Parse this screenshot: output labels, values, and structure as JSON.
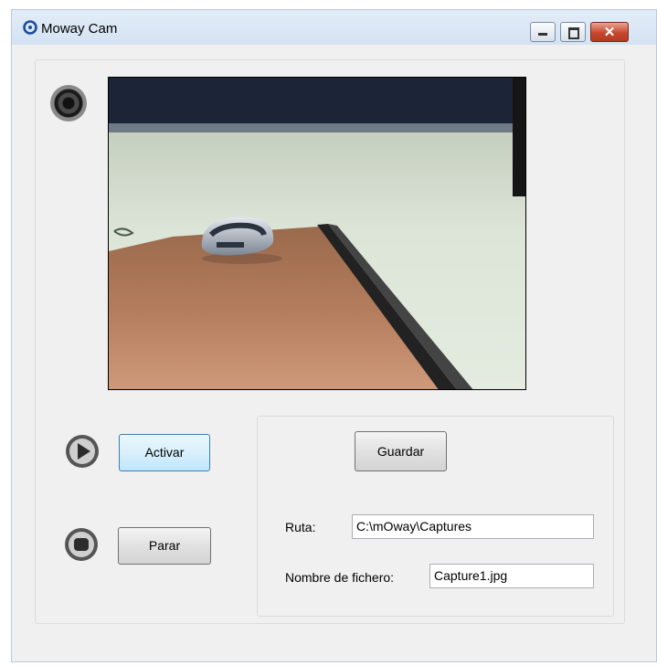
{
  "window": {
    "title": "Moway Cam",
    "close_glyph": "✕",
    "min_icon": "minimize-icon",
    "max_icon": "maximize-icon",
    "close_icon": "close-icon"
  },
  "icons": {
    "app": "moway-app-icon",
    "webcam": "webcam-icon",
    "play": "play-icon",
    "stop": "stop-icon"
  },
  "controls": {
    "activar_label": "Activar",
    "parar_label": "Parar"
  },
  "save_panel": {
    "guardar_label": "Guardar",
    "ruta_label": "Ruta:",
    "ruta_value": "C:\\mOway\\Captures",
    "filename_label": "Nombre de fichero:",
    "filename_value": "Capture1.jpg"
  },
  "colors": {
    "titlebar": "#dae6f4",
    "window_bg": "#f0f0f0",
    "close_button": "#c8462e",
    "focus_button": "#3c7fb1"
  }
}
